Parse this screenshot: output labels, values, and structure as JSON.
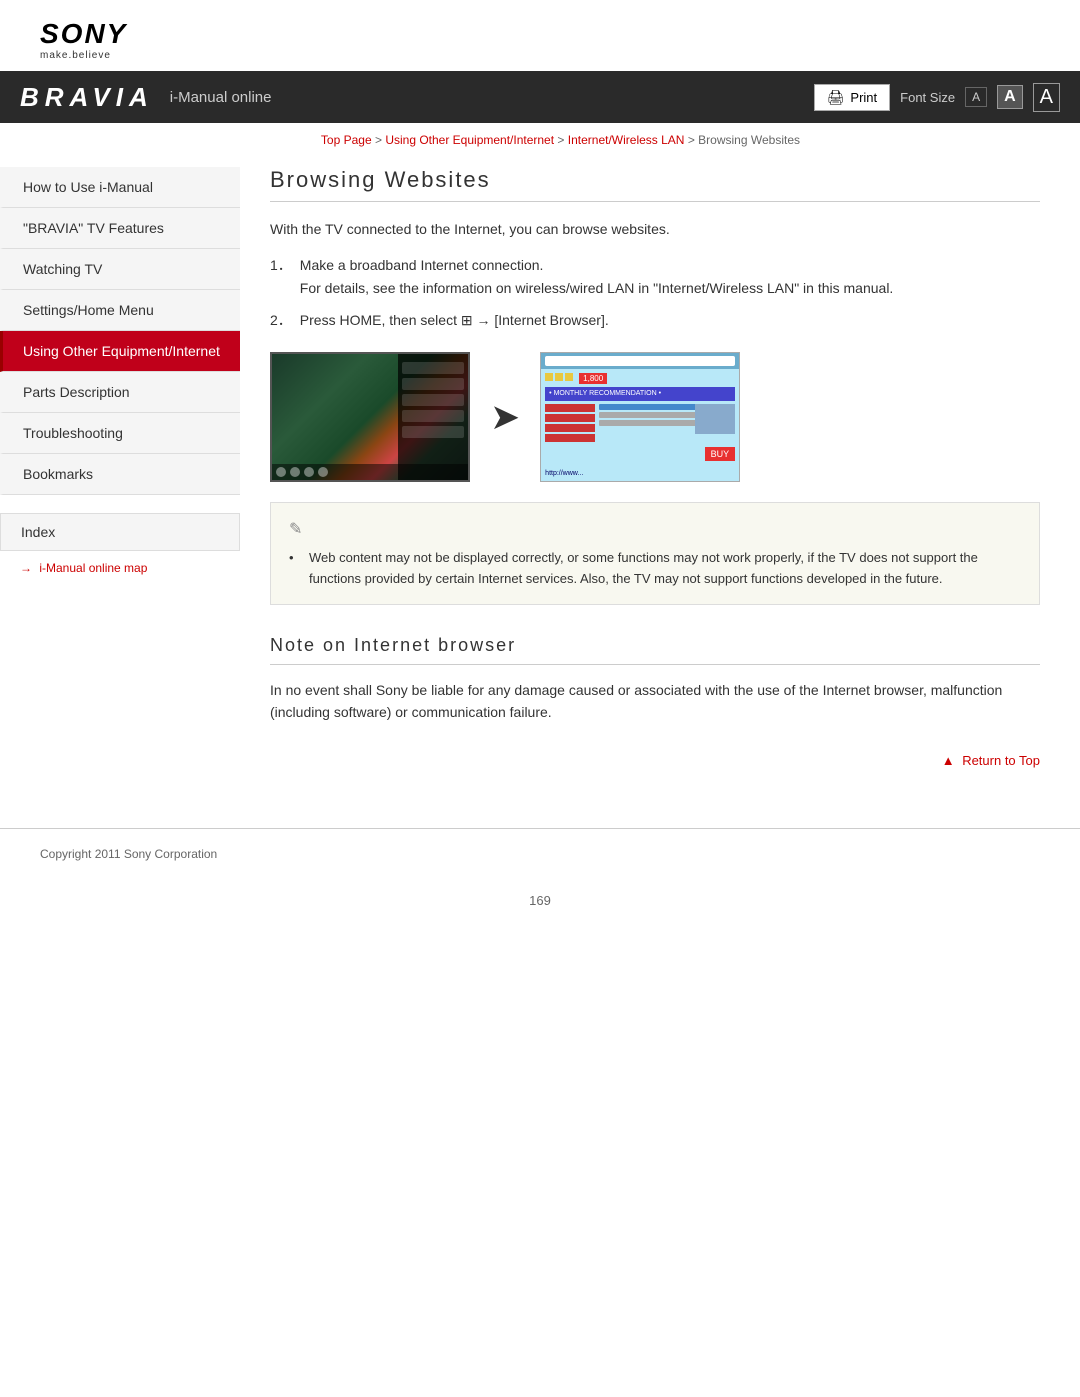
{
  "header": {
    "sony_logo": "SONY",
    "sony_tagline": "make.believe",
    "bravia_logo": "BRAVIA",
    "bravia_subtitle": "i-Manual online",
    "print_button": "Print",
    "font_size_label": "Font Size",
    "font_size_small": "A",
    "font_size_medium": "A",
    "font_size_large": "A"
  },
  "breadcrumb": {
    "top_page": "Top Page",
    "separator1": " > ",
    "link2": "Using Other Equipment/Internet",
    "separator2": " > ",
    "link3": "Internet/Wireless LAN",
    "separator3": " > ",
    "current": "Browsing Websites"
  },
  "sidebar": {
    "items": [
      {
        "id": "how-to-use",
        "label": "How to Use i-Manual",
        "active": false
      },
      {
        "id": "bravia-tv-features",
        "label": "\"BRAVIA\" TV Features",
        "active": false
      },
      {
        "id": "watching-tv",
        "label": "Watching TV",
        "active": false
      },
      {
        "id": "settings-home-menu",
        "label": "Settings/Home Menu",
        "active": false
      },
      {
        "id": "using-other-equipment",
        "label": "Using Other Equipment/Internet",
        "active": true
      },
      {
        "id": "parts-description",
        "label": "Parts Description",
        "active": false
      },
      {
        "id": "troubleshooting",
        "label": "Troubleshooting",
        "active": false
      },
      {
        "id": "bookmarks",
        "label": "Bookmarks",
        "active": false
      }
    ],
    "index_label": "Index",
    "map_link": "i-Manual online map",
    "map_arrow": "→"
  },
  "content": {
    "page_title": "Browsing Websites",
    "intro_text": "With the TV connected to the Internet, you can browse websites.",
    "step1_num": "1．",
    "step1_text": "Make a broadband Internet connection.",
    "step1_detail": "For details, see the information on wireless/wired LAN in \"Internet/Wireless LAN\" in this manual.",
    "step2_num": "2．",
    "step2_text": "Press HOME, then select  → [Internet Browser].",
    "note_icon": "✎",
    "note_text": "Web content may not be displayed correctly, or some functions may not work properly, if the TV does not support the functions provided by certain Internet services. Also, the TV may not support functions developed in the future.",
    "section2_title": "Note on Internet browser",
    "section2_text": "In no event shall Sony be liable for any damage caused or associated with the use of the Internet browser, malfunction (including software) or communication failure.",
    "return_to_top": "Return to Top",
    "return_arrow": "▲"
  },
  "footer": {
    "copyright": "Copyright 2011 Sony Corporation",
    "page_number": "169"
  }
}
